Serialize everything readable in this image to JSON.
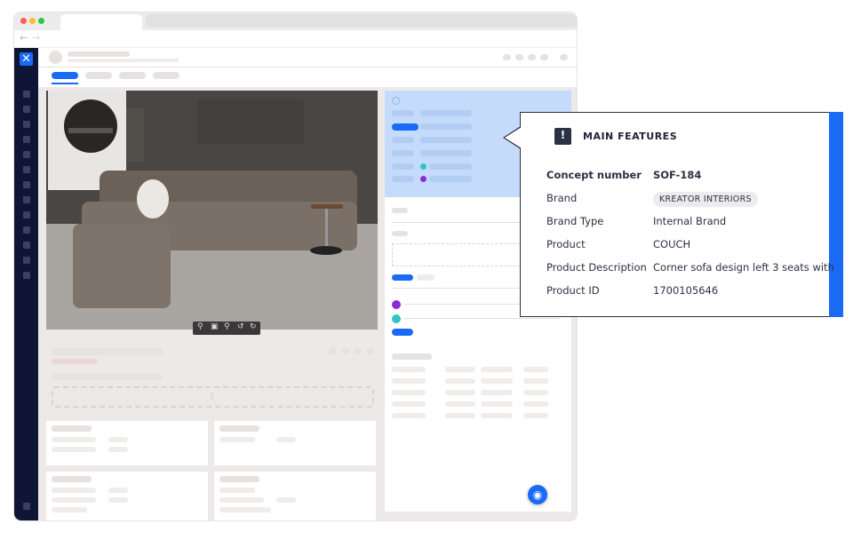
{
  "browser": {
    "back_icon": "arrow-left-icon",
    "forward_icon": "arrow-right-icon",
    "colors": {
      "close": "#ff5f57",
      "minimize": "#febc2e",
      "zoom": "#28c840"
    }
  },
  "sidebar": {
    "logo_icon": "x-logo-icon",
    "accent": "#1a6af5",
    "background": "#0f1534"
  },
  "image_toolbar": {
    "icons": [
      "zoom-in-icon",
      "fit-screen-icon",
      "zoom-out-icon",
      "rotate-left-icon",
      "rotate-right-icon"
    ]
  },
  "main_features": {
    "title": "MAIN FEATURES",
    "icon": "exclamation-icon",
    "rows": [
      {
        "label": "Concept number",
        "value": "SOF-184"
      },
      {
        "label": "Brand",
        "value": "KREATOR INTERIORS"
      },
      {
        "label": "Brand Type",
        "value": "Internal Brand"
      },
      {
        "label": "Product",
        "value": "COUCH"
      },
      {
        "label": "Product Description",
        "value": "Corner sofa design left 3 seats with"
      },
      {
        "label": "Product ID",
        "value": "1700105646"
      }
    ]
  },
  "fab_icon": "help-circle-icon"
}
